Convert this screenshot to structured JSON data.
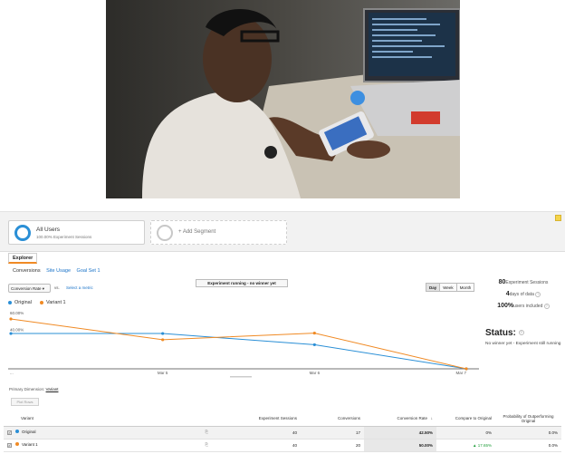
{
  "segments": [
    {
      "title": "All Users",
      "subtitle": "100.00% Experiment Sessions"
    },
    {
      "title": "+ Add Segment"
    }
  ],
  "tabs": {
    "explorer": "Explorer"
  },
  "sublinks": [
    "Conversions",
    "Site Usage",
    "Goal Set 1"
  ],
  "controls": {
    "metric": "Conversion Rate ▾",
    "vs": "vs.",
    "select_metric": "Select a metric",
    "banner": "Experiment running - no winner yet",
    "range": [
      "Day",
      "Week",
      "Month"
    ]
  },
  "stats": {
    "sessions_num": "80",
    "sessions_label": "Experiment Sessions",
    "days_num": "4",
    "days_label": "days of data",
    "users_num": "100%",
    "users_label": "users included"
  },
  "status": {
    "title": "Status:",
    "text": "No winner yet - Experiment still running"
  },
  "primary_dimension": {
    "label": "Primary Dimension:",
    "value": "Variant"
  },
  "plot_rows": "Plot Rows",
  "table": {
    "headers": [
      "Variant",
      "Experiment Sessions",
      "Conversions",
      "Conversion Rate",
      "Compare to Original",
      "Probability of Outperforming Original"
    ],
    "rows": [
      {
        "name": "Original",
        "color": "#2a8fd6",
        "sessions": "40",
        "conversions": "17",
        "rate": "42.50%",
        "compare": "",
        "prob": "0%",
        "prob2": "0.0%"
      },
      {
        "name": "Variant 1",
        "color": "#f08a24",
        "sessions": "40",
        "conversions": "20",
        "rate": "50.00%",
        "compare": "▲ 17.65%",
        "prob": "",
        "prob2": "0.0%"
      }
    ]
  },
  "chart_data": {
    "type": "line",
    "x": [
      "",
      "Mar 5",
      "Mar 6",
      "Mar 7"
    ],
    "ytick_labels": [
      "60.00%",
      "40.00%"
    ],
    "series": [
      {
        "name": "Original",
        "color": "#2a8fd6",
        "values": [
          42.5,
          42.5,
          29.0,
          0
        ]
      },
      {
        "name": "Variant 1",
        "color": "#f08a24",
        "values": [
          60.0,
          35.0,
          43.0,
          0
        ]
      }
    ],
    "ylim": [
      0,
      72
    ],
    "x_tick_labels": [
      "...",
      "Mar 5",
      "Mar 6",
      "Mar 7"
    ]
  },
  "colors": {
    "accent": "#f08a24",
    "link": "#1a73c8"
  }
}
